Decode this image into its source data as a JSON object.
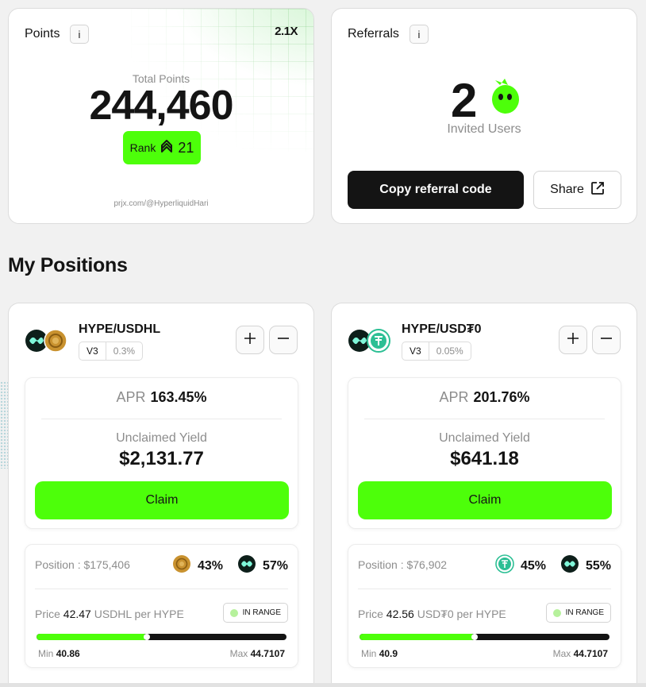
{
  "points": {
    "title": "Points",
    "info": "i",
    "multiplier": "2.1X",
    "total_label": "Total Points",
    "total_value": "244,460",
    "rank_label": "Rank",
    "rank_value": "21",
    "profile_link": "prjx.com/@HyperliquidHari"
  },
  "referrals": {
    "title": "Referrals",
    "info": "i",
    "invited_count": "2",
    "invited_label": "Invited Users",
    "copy_label": "Copy referral code",
    "share_label": "Share"
  },
  "section_title": "My Positions",
  "positions": [
    {
      "pair": "HYPE/USDHL",
      "version": "V3",
      "fee": "0.3%",
      "apr_label": "APR",
      "apr": "163.45%",
      "unclaimed_label": "Unclaimed Yield",
      "unclaimed": "$2,131.77",
      "claim_label": "Claim",
      "position_text": "Position : $175,406",
      "share_a": "43%",
      "share_b": "57%",
      "price_label": "Price",
      "price": "42.47",
      "price_unit": "USDHL per HYPE",
      "range_status": "IN RANGE",
      "range_progress": 0.44,
      "min_label": "Min",
      "min": "40.86",
      "max_label": "Max",
      "max": "44.7107",
      "icon_a": "usdhl-token-icon",
      "icon_b": "hype-token-icon"
    },
    {
      "pair": "HYPE/USD₮0",
      "version": "V3",
      "fee": "0.05%",
      "apr_label": "APR",
      "apr": "201.76%",
      "unclaimed_label": "Unclaimed Yield",
      "unclaimed": "$641.18",
      "claim_label": "Claim",
      "position_text": "Position : $76,902",
      "share_a": "45%",
      "share_b": "55%",
      "price_label": "Price",
      "price": "42.56",
      "price_unit": "USD₮0 per HYPE",
      "range_status": "IN RANGE",
      "range_progress": 0.46,
      "min_label": "Min",
      "min": "40.9",
      "max_label": "Max",
      "max": "44.7107",
      "icon_a": "usdt0-token-icon",
      "icon_b": "hype-token-icon"
    }
  ],
  "colors": {
    "accent": "#4dff0a",
    "dark": "#141414",
    "muted": "#8d8d8d",
    "hype": "#0d1f1a",
    "usdhl": "#c9922f",
    "usdt0": "#2cbf94"
  }
}
